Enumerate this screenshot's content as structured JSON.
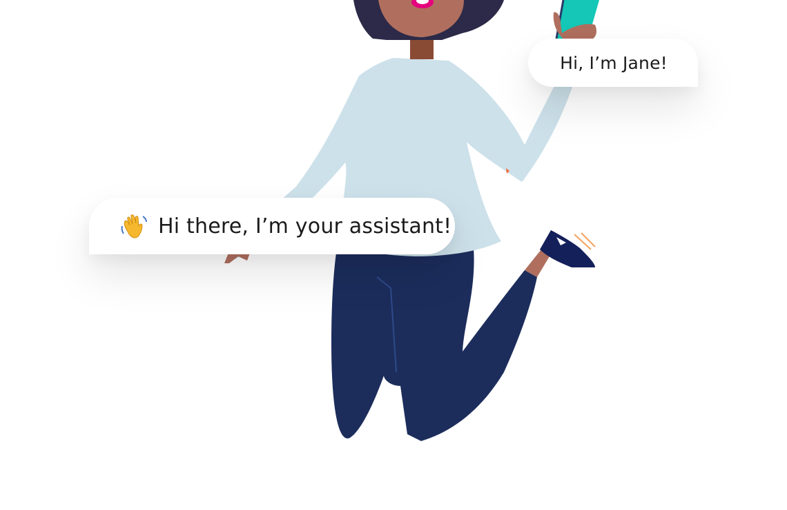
{
  "scene": {
    "illustration": "jumping-woman-with-phone",
    "colors": {
      "background": "#ffffff",
      "sweater": "#cde1ea",
      "pants": "#1c2d5c",
      "skin": "#b06f5e",
      "neck": "#8a4b35",
      "hair": "#2c2a48",
      "phone": "#14c7b6",
      "shoe": "#14205a",
      "lips": "#e5007e"
    }
  },
  "bubbles": {
    "jane": {
      "text": "Hi, I’m Jane!"
    },
    "assistant": {
      "icon": "waving-hand-icon",
      "text": "Hi there, I’m your assistant!"
    }
  }
}
